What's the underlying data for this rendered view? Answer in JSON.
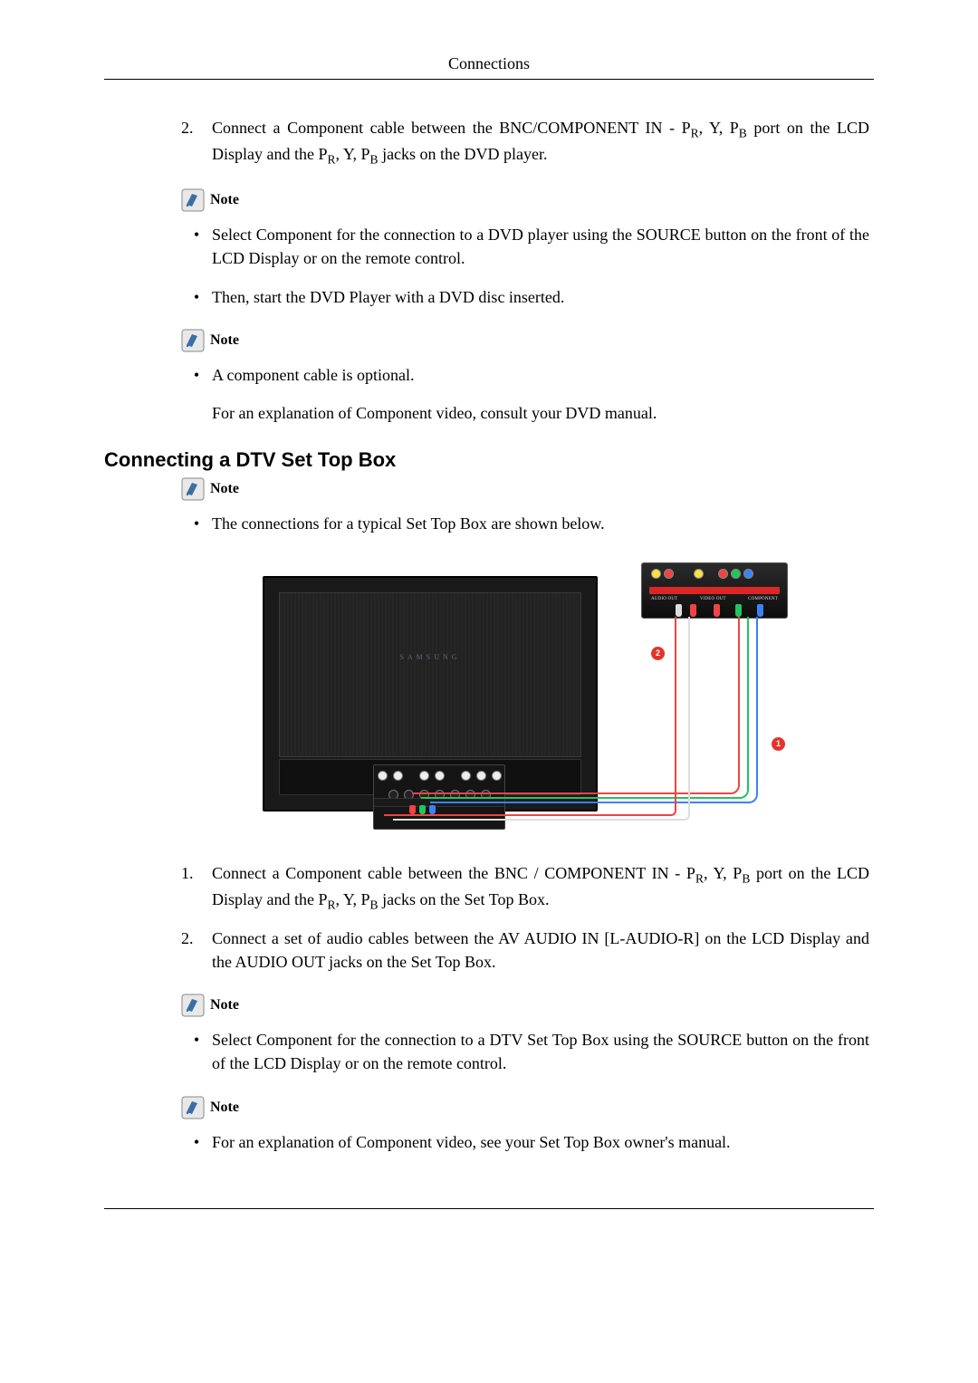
{
  "header": {
    "title": "Connections"
  },
  "steps_top": [
    {
      "num": "2.",
      "text": "Connect a Component cable between the BNC/COMPONENT IN - P",
      "sub1": "R",
      "text2": ", Y, P",
      "sub2": "B",
      "text3": " port on the LCD Display and the P",
      "sub3": "R",
      "text4": ", Y, P",
      "sub4": "B",
      "text5": " jacks on the DVD player."
    }
  ],
  "note_label": "Note",
  "note1_bullets": [
    "Select Component for the connection to a DVD player using the SOURCE button on the front of the LCD Display or on the remote control.",
    "Then, start the DVD Player with a DVD disc inserted."
  ],
  "note2_bullets": [
    "A component cable is optional."
  ],
  "note2_extra": "For an explanation of Component video, consult your DVD manual.",
  "section_title": "Connecting a DTV Set Top Box",
  "note3_bullets": [
    "The connections for a typical Set Top Box are shown below."
  ],
  "diagram": {
    "stb_labels": {
      "audio": "AUDIO OUT",
      "video": "VIDEO OUT",
      "component": "COMPONENT"
    },
    "tv_logo": "SAMSUNG",
    "callout1": "1",
    "callout2": "2"
  },
  "steps_bottom": [
    {
      "num": "1.",
      "text": "Connect a Component cable between the BNC / COMPONENT IN - P",
      "sub1": "R",
      "text2": ", Y, P",
      "sub2": "B",
      "text3": " port on the LCD Display and the P",
      "sub3": "R",
      "text4": ", Y, P",
      "sub4": "B",
      "text5": " jacks on the Set Top Box."
    },
    {
      "num": "2.",
      "plain": "Connect a set of audio cables between the AV AUDIO IN [L-AUDIO-R] on the LCD Display and the AUDIO OUT jacks on the Set Top Box."
    }
  ],
  "note4_bullets": [
    "Select Component for the connection to a DTV Set Top Box using the SOURCE button on the front of the LCD Display or on the remote control."
  ],
  "note5_bullets": [
    "For an explanation of Component video, see your Set Top Box owner's manual."
  ]
}
